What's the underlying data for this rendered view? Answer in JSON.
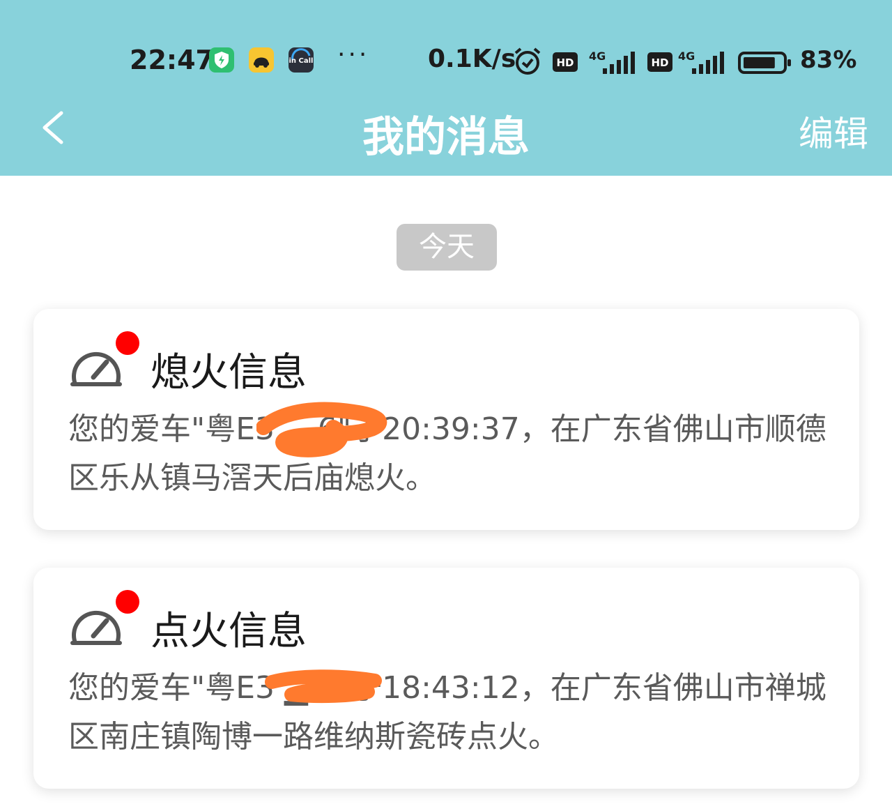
{
  "status_bar": {
    "time": "22:47",
    "app_icons": [
      "shield-app-icon",
      "car-app-icon",
      "incall-app-icon"
    ],
    "incall_label": "in Call",
    "overflow": "···",
    "net_speed": "0.1K/s",
    "hd_label": "HD",
    "network_label": "4G",
    "battery_pct": "83%",
    "battery_level": 0.83
  },
  "header": {
    "title": "我的消息",
    "edit_label": "编辑"
  },
  "date_label": "今天",
  "messages": [
    {
      "title": "熄火信息",
      "body": "您的爱车\"粤E3 ▁ 6\"于20:39:37，在广东省佛山市顺德区乐从镇马滘天后庙熄火。"
    },
    {
      "title": "点火信息",
      "body": "您的爱车\"粤E3 ▁ 6\"于18:43:12，在广东省佛山市禅城区南庄镇陶博一路维纳斯瓷砖点火。"
    }
  ],
  "colors": {
    "header_bg": "#88d2db",
    "unread_dot": "#ff0000",
    "scribble": "#ff7a2e"
  }
}
